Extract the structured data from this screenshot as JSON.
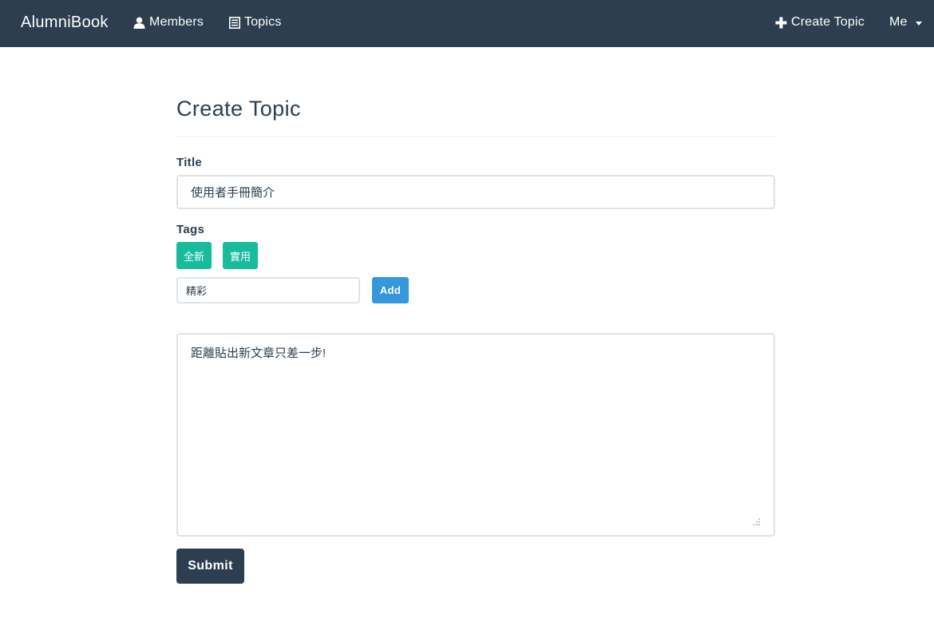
{
  "navbar": {
    "brand": "AlumniBook",
    "members_label": "Members",
    "members_icon": "user-icon",
    "topics_label": "Topics",
    "topics_icon": "list-icon",
    "create_topic_label": "Create Topic",
    "create_topic_icon": "plus-icon",
    "me_label": "Me",
    "me_icon": "caret-down-icon"
  },
  "form": {
    "heading": "Create Topic",
    "title_label": "Title",
    "title_value": "使用者手冊簡介",
    "tags_label": "Tags",
    "tags": [
      "全新",
      "實用"
    ],
    "tag_input_value": "精彩",
    "add_label": "Add",
    "content_value": "距離貼出新文章只差一步!",
    "submit_label": "Submit"
  },
  "colors": {
    "navbar_bg": "#2c3e50",
    "tag_bg": "#18bc9c",
    "add_button_bg": "#3498db",
    "submit_bg": "#2c3e50",
    "input_border": "#dce4ec"
  }
}
